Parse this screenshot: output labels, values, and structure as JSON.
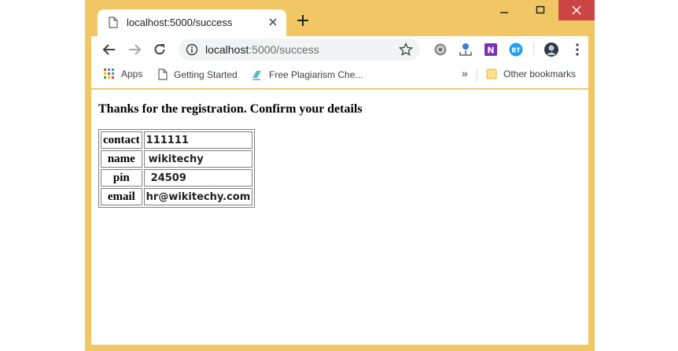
{
  "browser": {
    "tab": {
      "title": "localhost:5000/success"
    },
    "address_bar": {
      "host": "localhost",
      "path": ":5000/success"
    },
    "bookmarks": {
      "apps_label": "Apps",
      "items": [
        "Getting Started",
        "Free Plagiarism Che..."
      ],
      "overflow": "»",
      "other": "Other bookmarks"
    },
    "extensions": [
      "settings-gear-icon",
      "download-extension-icon",
      "onenote-icon",
      "bt-icon",
      "profile-avatar-icon"
    ],
    "extension_labels": {
      "onenote": "N",
      "bt": "BT"
    }
  },
  "page": {
    "heading": "Thanks for the registration. Confirm your details",
    "details": [
      {
        "key": "contact",
        "value": "111111"
      },
      {
        "key": "name",
        "value": "wikitechy"
      },
      {
        "key": "pin",
        "value": "24509"
      },
      {
        "key": "email",
        "value": "hr@wikitechy.com"
      }
    ]
  },
  "colors": {
    "frame": "#f1c765",
    "close_button": "#cc4545",
    "omnibox": "#f1f3f4",
    "bt_badge": "#1da1f2",
    "onenote": "#7b2fb5"
  }
}
